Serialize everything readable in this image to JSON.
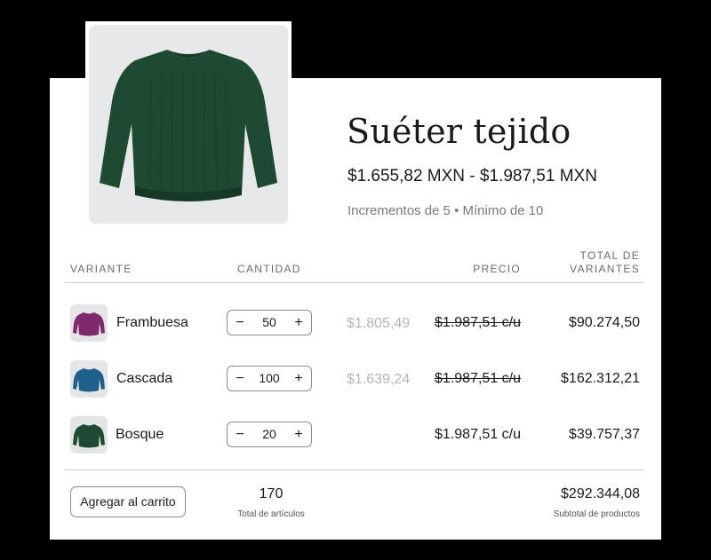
{
  "product": {
    "title": "Suéter tejido",
    "price_range": "$1.655,82 MXN - $1.987,51 MXN",
    "increments": "Incrementos de 5 • Mínimo de 10",
    "image": "green-knit-sweater-photo",
    "color": "#1f4a32"
  },
  "table": {
    "headers": {
      "variant": "VARIANTE",
      "quantity": "CANTIDAD",
      "price": "PRECIO",
      "total_line1": "TOTAL DE",
      "total_line2": "VARIANTES"
    },
    "rows": [
      {
        "name": "Frambuesa",
        "color": "#7e2a6a",
        "quantity": "50",
        "discount_price": "$1.805,49",
        "unit_price": "$1.987,51 c/u",
        "unit_strikethrough": true,
        "total": "$90.274,50"
      },
      {
        "name": "Cascada",
        "color": "#1f5f8c",
        "quantity": "100",
        "discount_price": "$1.639,24",
        "unit_price": "$1.987,51 c/u",
        "unit_strikethrough": true,
        "total": "$162.312,21"
      },
      {
        "name": "Bosque",
        "color": "#1f4a32",
        "quantity": "20",
        "discount_price": "",
        "unit_price": "$1.987,51 c/u",
        "unit_strikethrough": false,
        "total": "$39.757,37"
      }
    ],
    "stepper": {
      "minus": "−",
      "plus": "+"
    }
  },
  "footer": {
    "add_to_cart": "Agregar al carrito",
    "total_items": "170",
    "total_items_label": "Total de artículos",
    "subtotal": "$292.344,08",
    "subtotal_label": "Subtotal de productos"
  }
}
